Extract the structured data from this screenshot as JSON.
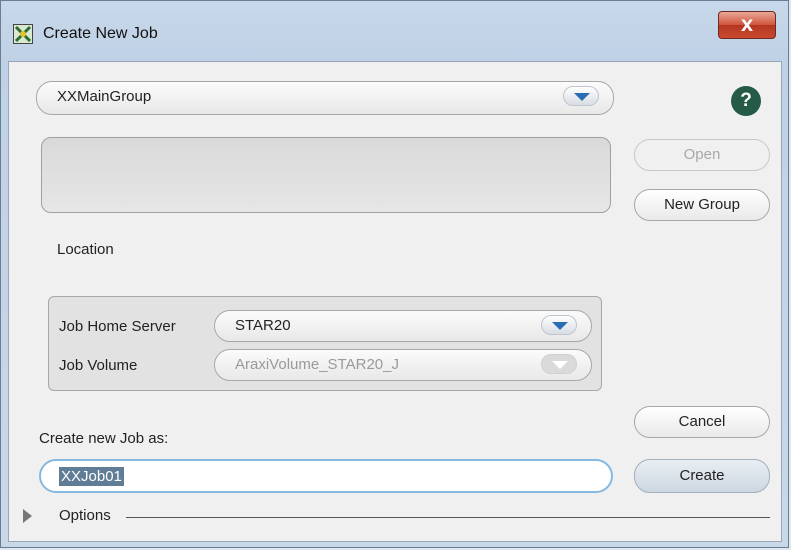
{
  "window": {
    "title": "Create New Job",
    "close_glyph": "X"
  },
  "group_select": {
    "value": "XXMainGroup"
  },
  "help": {
    "glyph": "?"
  },
  "buttons": {
    "open": "Open",
    "new_group": "New Group",
    "cancel": "Cancel",
    "create": "Create"
  },
  "location": {
    "label": "Location",
    "server_label": "Job Home Server",
    "server_value": "STAR20",
    "volume_label": "Job Volume",
    "volume_value": "AraxiVolume_STAR20_J"
  },
  "job": {
    "label": "Create new Job as:",
    "name": "XXJob01"
  },
  "options": {
    "label": "Options"
  },
  "icons": [
    "app-icon",
    "close-icon",
    "chevron-down-icon",
    "help-icon",
    "expand-triangle-icon"
  ],
  "colors": {
    "help_bg": "#255b46",
    "accent_arrow": "#2a6db5",
    "focus_border": "#86b9e2"
  }
}
